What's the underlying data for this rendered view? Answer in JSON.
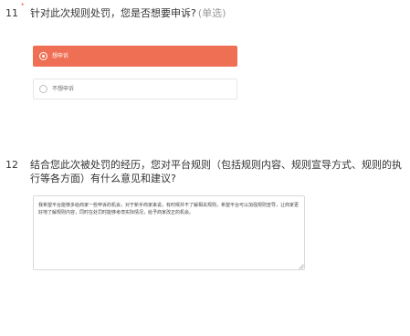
{
  "question11": {
    "number": "11",
    "required_mark": "*",
    "title": "针对此次规则处罚，您是否想要申诉?",
    "type": "(单选)",
    "options": [
      {
        "label": "想申诉",
        "selected": true
      },
      {
        "label": "不想申诉",
        "selected": false
      }
    ]
  },
  "question12": {
    "number": "12",
    "title_line1": "结合您此次被处罚的经历，您对平台规则（包括规则内容、规则宣导方式、规则的执",
    "title_line2": "行等各方面）有什么意见和建议?",
    "answer": "我希望平台能够多给商家一些申诉的机会，对于新手商家来说，有时候并不了解相关规则，希望平台可以加强规则宣导，让商家更好地了解规则内容，同时在处罚时能够考虑实际情况，给予商家改正的机会。"
  },
  "colors": {
    "accent": "#ef6f55",
    "required": "#e54e3d"
  }
}
